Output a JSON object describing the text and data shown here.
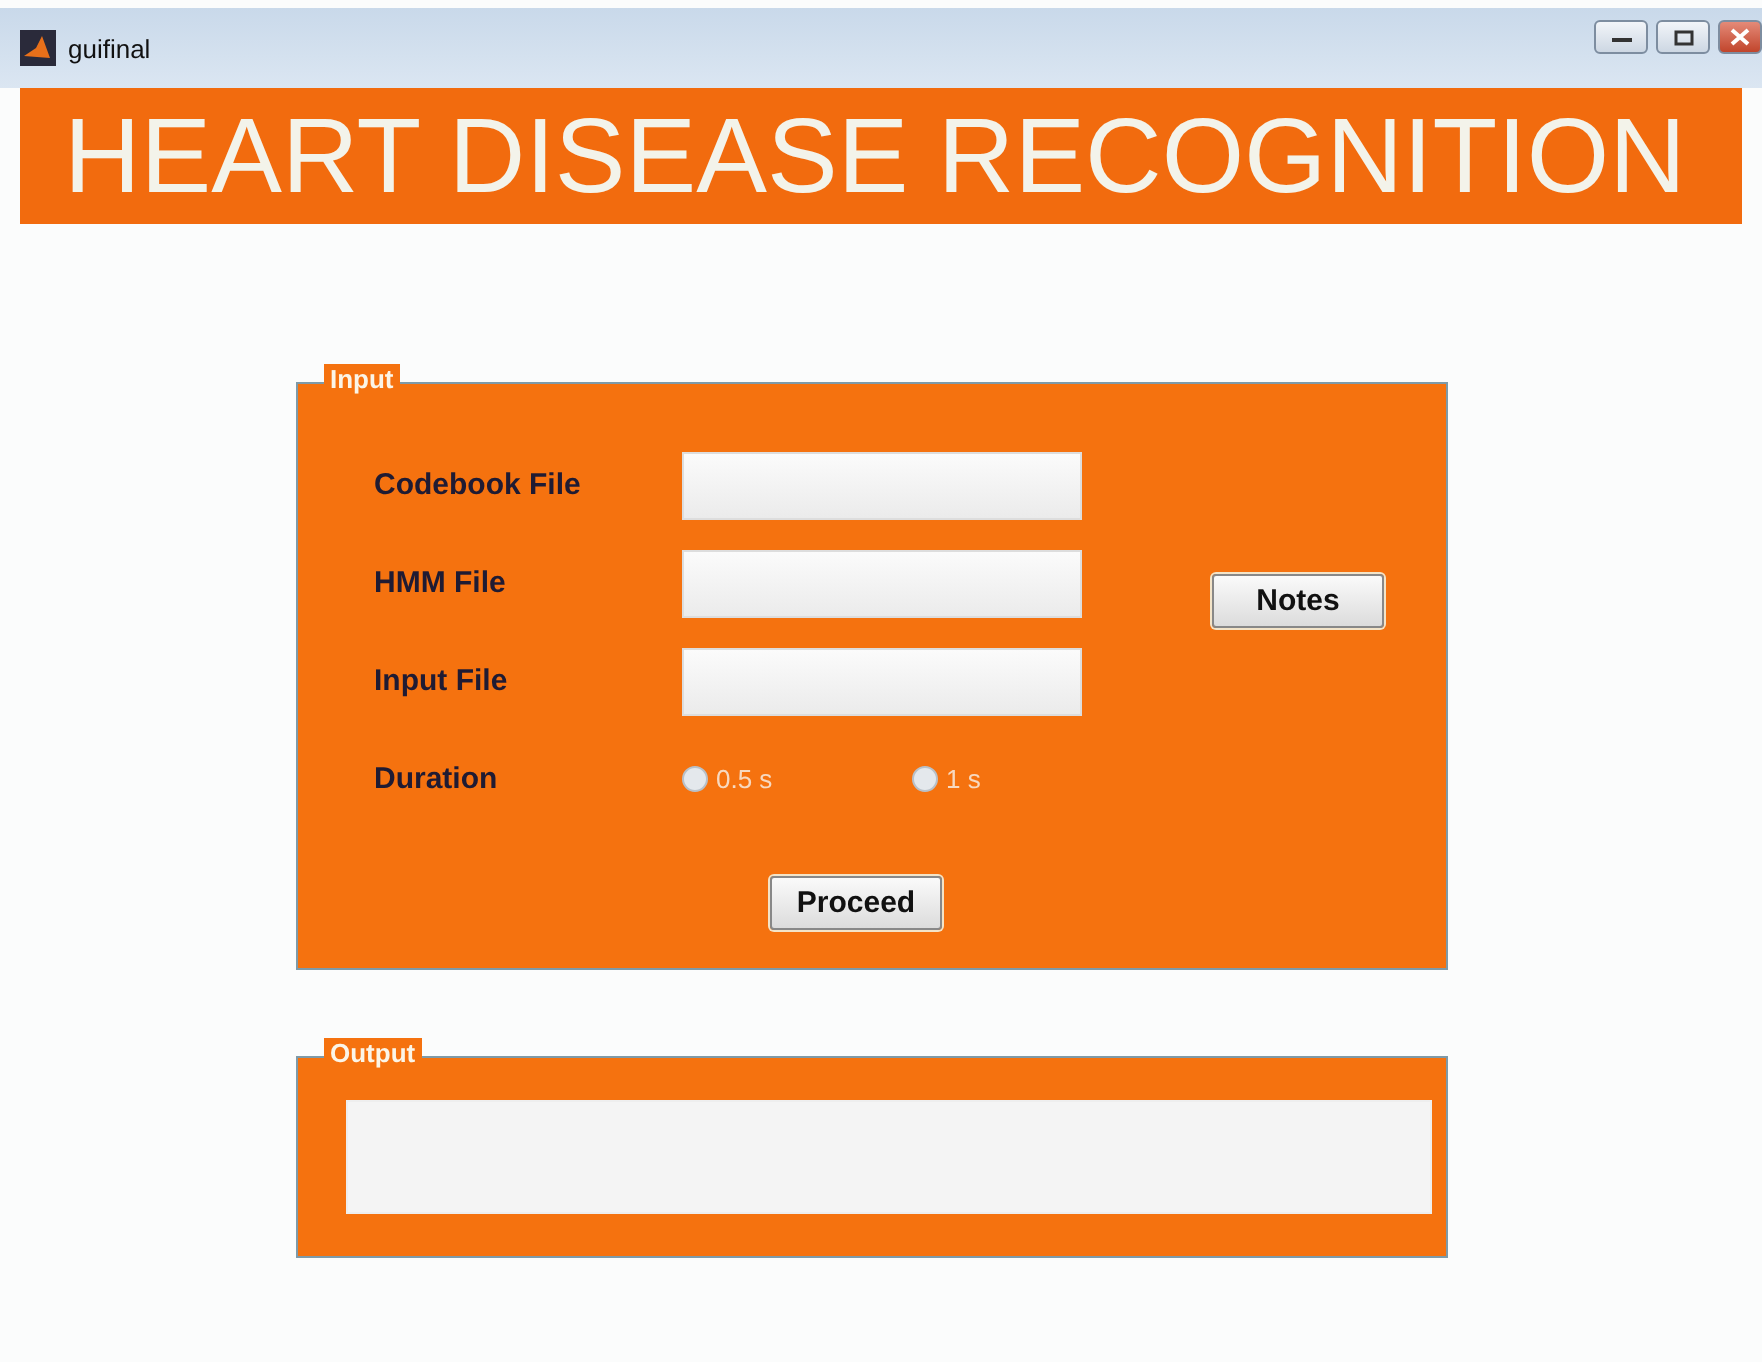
{
  "window": {
    "title": "guifinal"
  },
  "banner": {
    "title": "HEART DISEASE RECOGNITION"
  },
  "input_panel": {
    "legend": "Input",
    "fields": [
      {
        "label": "Codebook File"
      },
      {
        "label": "HMM File"
      },
      {
        "label": "Input File"
      }
    ],
    "duration": {
      "label": "Duration",
      "options": [
        {
          "label": "0.5 s",
          "selected": false
        },
        {
          "label": "1 s",
          "selected": false
        }
      ]
    },
    "notes_button": "Notes",
    "proceed_button": "Proceed"
  },
  "output_panel": {
    "legend": "Output"
  }
}
